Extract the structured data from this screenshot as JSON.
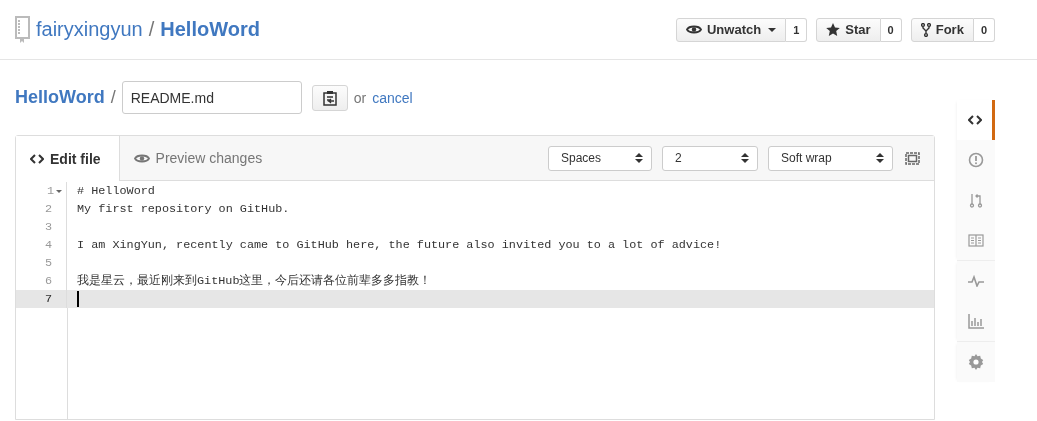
{
  "header": {
    "owner": "fairyxingyun",
    "separator": "/",
    "repo": "HelloWord",
    "actions": [
      {
        "kind": "watch",
        "label": "Unwatch",
        "count": "1"
      },
      {
        "kind": "star",
        "label": "Star",
        "count": "0"
      },
      {
        "kind": "fork",
        "label": "Fork",
        "count": "0"
      }
    ]
  },
  "breadcrumb": {
    "repo": "HelloWord",
    "separator": "/",
    "filename": "README.md",
    "or": "or",
    "cancel": "cancel"
  },
  "editor": {
    "tabs": [
      {
        "kind": "code",
        "label": "Edit file",
        "selected": true
      },
      {
        "kind": "eye",
        "label": "Preview changes",
        "selected": false
      }
    ],
    "selects": [
      "Spaces",
      "2",
      "Soft wrap"
    ],
    "lines": [
      {
        "number": "1",
        "text": "# HelloWord",
        "foldable": true,
        "active": false
      },
      {
        "number": "2",
        "text": "My first repository on GitHub.",
        "foldable": false,
        "active": false
      },
      {
        "number": "3",
        "foldable": false,
        "active": false
      },
      {
        "number": "4",
        "text": "I am XingYun, recently came to GitHub here, the future also invited you to a lot of advice!",
        "foldable": false,
        "active": false
      },
      {
        "number": "5",
        "foldable": false,
        "active": false
      },
      {
        "number": "6",
        "text": "我是星云，最近刚来到GitHub这里，今后还请各位前辈多多指教！",
        "foldable": false,
        "active": false
      },
      {
        "number": "7",
        "foldable": false,
        "active": true
      }
    ]
  },
  "repo_nav": {
    "groups": [
      [
        {
          "kind": "code",
          "selected": true
        },
        {
          "kind": "issues",
          "selected": false
        },
        {
          "kind": "pull-request",
          "selected": false
        },
        {
          "kind": "wiki",
          "selected": false
        }
      ],
      [
        {
          "kind": "pulse",
          "selected": false
        },
        {
          "kind": "graphs",
          "selected": false
        }
      ],
      [
        {
          "kind": "settings",
          "selected": false
        }
      ]
    ]
  }
}
